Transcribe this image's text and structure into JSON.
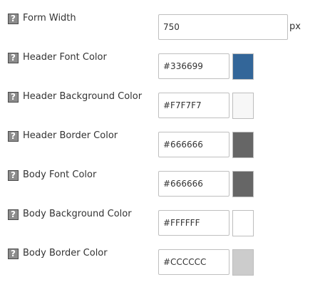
{
  "help_icon_glyph": "?",
  "fields": [
    {
      "label": "Form Width",
      "value": "750",
      "unit": "px"
    },
    {
      "label": "Header Font Color",
      "value": "#336699",
      "swatch": "#336699"
    },
    {
      "label": "Header Background Color",
      "value": "#F7F7F7",
      "swatch": "#F7F7F7"
    },
    {
      "label": "Header Border Color",
      "value": "#666666",
      "swatch": "#666666"
    },
    {
      "label": "Body Font Color",
      "value": "#666666",
      "swatch": "#666666"
    },
    {
      "label": "Body Background Color",
      "value": "#FFFFFF",
      "swatch": "#FFFFFF"
    },
    {
      "label": "Body Border Color",
      "value": "#CCCCCC",
      "swatch": "#CCCCCC"
    }
  ]
}
